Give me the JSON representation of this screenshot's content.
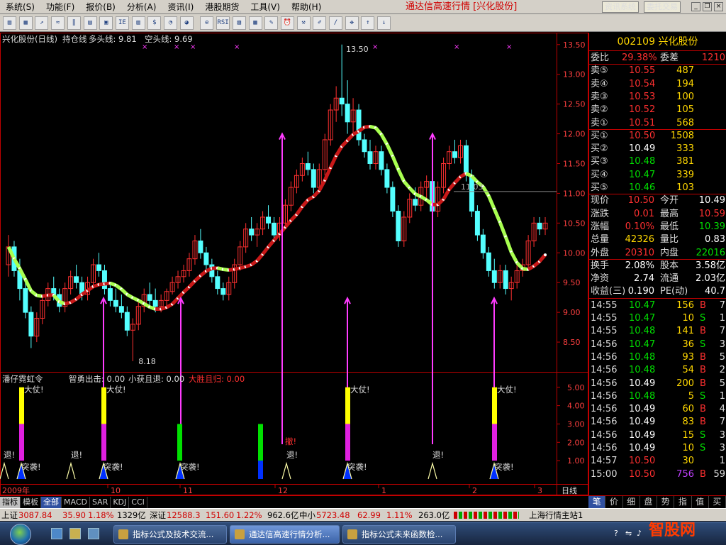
{
  "menubar": {
    "items": [
      "系统(S)",
      "功能(F)",
      "报价(B)",
      "分析(A)",
      "资讯(I)",
      "港股期货",
      "工具(V)",
      "帮助(H)"
    ],
    "app_title": "通达信高速行情 [兴化股份]",
    "news_button": "资讯系统",
    "trade_button": "委托交易"
  },
  "toolbar": {
    "icons": [
      "chart-icon",
      "table-icon",
      "line-chart-icon",
      "trend-icon",
      "candle-icon",
      "layout-icon",
      "depth-icon",
      "report-icon",
      "db-icon",
      "money-icon",
      "pie-icon",
      "pie2-icon",
      "ie-icon",
      "rsi-icon",
      "screen-icon",
      "grid-icon",
      "pen-icon",
      "alarm-icon",
      "tools-icon",
      "sign-icon",
      "draw-icon",
      "move-icon",
      "up-arrow-icon",
      "down-arrow-icon"
    ],
    "labels": [
      "▥",
      "▦",
      "↗",
      "≈",
      "‖",
      "▤",
      "▣",
      "IE",
      "▥",
      "$",
      "◔",
      "◕",
      "e",
      "RSI",
      "▧",
      "▦",
      "✎",
      "⏰",
      "⚒",
      "✐",
      "/",
      "✥",
      "↑",
      "↓"
    ]
  },
  "chart": {
    "header_stock": "兴化股份(日线)",
    "header_indicator": "持仓线",
    "long_line_label": "多头线: 9.81",
    "short_line_label": "空头线: 9.69",
    "price_ticks": [
      "13.50",
      "13.00",
      "12.50",
      "12.00",
      "11.50",
      "11.00",
      "10.50",
      "10.00",
      "9.50",
      "9.00",
      "8.50"
    ],
    "high_label": "13.50",
    "low_label": "8.18",
    "hline_label": "11.03",
    "sub_title": "潘仔霓虹令",
    "sub_label1": "智勇出击: 0.00",
    "sub_label2": "小获且退: 0.00",
    "sub_label3": "大胜且归: 0.00",
    "sub_ticks": [
      "5.00",
      "4.00",
      "3.00",
      "2.00",
      "1.00"
    ],
    "date_labels": [
      "2009年",
      "10",
      "11",
      "12",
      "1",
      "2",
      "3"
    ],
    "period": "日线",
    "sig_buy": "大仗!",
    "sig_exit": "退!",
    "sig_raid": "突袭!",
    "sig_retreat": "撤!",
    "colors": {
      "up": "#ff3030",
      "down": "#54ffff",
      "long": "#a8ff50",
      "short": "#c81818",
      "arrow": "#ff3cff",
      "yellow": "#ffff00",
      "magenta": "#e020e0",
      "green": "#00e000",
      "blue": "#0030ff"
    }
  },
  "chart_data": {
    "type": "candlestick",
    "ylim": [
      8.0,
      13.7
    ],
    "candles": [
      [
        9.8,
        10.3,
        9.6,
        10.1
      ],
      [
        10.1,
        10.2,
        9.6,
        9.7
      ],
      [
        9.7,
        9.9,
        9.2,
        9.4
      ],
      [
        9.4,
        9.5,
        8.9,
        9.0
      ],
      [
        9.0,
        9.1,
        8.4,
        8.6
      ],
      [
        8.6,
        9.0,
        8.5,
        8.9
      ],
      [
        8.9,
        9.3,
        8.8,
        9.2
      ],
      [
        9.2,
        9.5,
        9.1,
        9.4
      ],
      [
        9.4,
        9.6,
        9.2,
        9.3
      ],
      [
        9.3,
        9.4,
        9.0,
        9.1
      ],
      [
        9.1,
        9.5,
        9.0,
        9.4
      ],
      [
        9.4,
        9.7,
        9.3,
        9.6
      ],
      [
        9.6,
        9.8,
        9.4,
        9.5
      ],
      [
        9.5,
        9.6,
        9.2,
        9.3
      ],
      [
        9.3,
        9.6,
        9.2,
        9.5
      ],
      [
        9.5,
        9.9,
        9.4,
        9.8
      ],
      [
        9.8,
        10.0,
        9.6,
        9.7
      ],
      [
        9.7,
        9.8,
        9.3,
        9.4
      ],
      [
        9.4,
        9.5,
        9.1,
        9.2
      ],
      [
        9.2,
        9.4,
        9.0,
        9.1
      ],
      [
        9.1,
        9.3,
        8.9,
        9.0
      ],
      [
        9.0,
        9.1,
        8.6,
        8.7
      ],
      [
        8.7,
        8.9,
        8.18,
        8.8
      ],
      [
        8.8,
        9.2,
        8.7,
        9.1
      ],
      [
        9.1,
        9.4,
        9.0,
        9.3
      ],
      [
        9.3,
        9.5,
        9.1,
        9.2
      ],
      [
        9.2,
        9.4,
        9.0,
        9.1
      ],
      [
        9.1,
        9.3,
        9.0,
        9.2
      ],
      [
        9.2,
        9.4,
        9.1,
        9.35
      ],
      [
        9.35,
        9.6,
        9.3,
        9.5
      ],
      [
        9.5,
        9.7,
        9.4,
        9.6
      ],
      [
        9.6,
        9.8,
        9.5,
        9.7
      ],
      [
        9.7,
        10.0,
        9.6,
        9.9
      ],
      [
        9.9,
        10.3,
        9.8,
        10.2
      ],
      [
        10.2,
        10.4,
        9.9,
        10.0
      ],
      [
        10.0,
        10.1,
        9.7,
        9.8
      ],
      [
        9.8,
        9.9,
        9.5,
        9.6
      ],
      [
        9.6,
        9.7,
        9.3,
        9.4
      ],
      [
        9.4,
        9.5,
        9.2,
        9.3
      ],
      [
        9.3,
        9.6,
        9.2,
        9.5
      ],
      [
        9.5,
        9.9,
        9.4,
        9.8
      ],
      [
        9.8,
        10.2,
        9.7,
        10.1
      ],
      [
        10.1,
        10.5,
        10.0,
        10.4
      ],
      [
        10.4,
        10.6,
        10.2,
        10.3
      ],
      [
        10.3,
        10.5,
        10.1,
        10.4
      ],
      [
        10.4,
        10.7,
        10.3,
        10.6
      ],
      [
        10.6,
        10.8,
        10.4,
        10.5
      ],
      [
        10.5,
        10.6,
        10.2,
        10.3
      ],
      [
        10.3,
        10.6,
        10.2,
        10.5
      ],
      [
        10.5,
        10.9,
        10.4,
        10.8
      ],
      [
        10.8,
        11.2,
        10.7,
        11.1
      ],
      [
        11.1,
        11.4,
        11.0,
        11.3
      ],
      [
        11.3,
        11.6,
        11.2,
        11.5
      ],
      [
        11.5,
        11.7,
        11.3,
        11.4
      ],
      [
        11.4,
        11.5,
        11.0,
        11.1
      ],
      [
        11.1,
        11.5,
        11.0,
        11.4
      ],
      [
        11.4,
        12.0,
        11.3,
        11.9
      ],
      [
        11.9,
        12.5,
        11.8,
        12.4
      ],
      [
        12.4,
        12.8,
        12.2,
        12.6
      ],
      [
        12.6,
        13.5,
        12.3,
        12.5
      ],
      [
        12.5,
        12.9,
        12.0,
        12.2
      ],
      [
        12.2,
        12.6,
        12.0,
        12.4
      ],
      [
        12.4,
        12.5,
        11.8,
        11.9
      ],
      [
        11.9,
        12.0,
        11.6,
        11.7
      ],
      [
        11.7,
        11.9,
        11.4,
        11.5
      ],
      [
        11.5,
        11.8,
        11.4,
        11.7
      ],
      [
        11.7,
        11.8,
        11.3,
        11.4
      ],
      [
        11.4,
        11.5,
        11.0,
        11.1
      ],
      [
        11.1,
        11.2,
        10.6,
        10.7
      ],
      [
        10.7,
        10.8,
        10.1,
        10.2
      ],
      [
        10.2,
        10.7,
        10.1,
        10.6
      ],
      [
        10.6,
        11.0,
        10.5,
        10.9
      ],
      [
        10.9,
        11.1,
        10.7,
        10.8
      ],
      [
        10.8,
        11.2,
        10.7,
        11.1
      ],
      [
        11.1,
        11.3,
        10.9,
        11.2
      ],
      [
        11.2,
        11.3,
        10.6,
        10.7
      ],
      [
        10.7,
        11.2,
        10.6,
        11.1
      ],
      [
        11.1,
        11.6,
        11.0,
        11.5
      ],
      [
        11.5,
        11.8,
        11.4,
        11.7
      ],
      [
        11.7,
        11.9,
        11.5,
        11.6
      ],
      [
        11.6,
        11.9,
        11.5,
        11.8
      ],
      [
        11.8,
        11.9,
        11.2,
        11.3
      ],
      [
        11.3,
        11.4,
        10.6,
        10.7
      ],
      [
        10.7,
        10.8,
        10.2,
        10.3
      ],
      [
        10.3,
        10.4,
        9.9,
        10.0
      ],
      [
        10.0,
        10.1,
        9.6,
        9.7
      ],
      [
        9.7,
        9.9,
        9.4,
        9.5
      ],
      [
        9.5,
        9.8,
        9.4,
        9.7
      ],
      [
        9.7,
        9.8,
        9.3,
        9.4
      ],
      [
        9.4,
        9.6,
        9.2,
        9.5
      ],
      [
        9.5,
        9.8,
        9.4,
        9.7
      ],
      [
        9.7,
        9.9,
        9.6,
        9.8
      ],
      [
        9.8,
        10.3,
        9.7,
        10.2
      ],
      [
        10.2,
        10.6,
        10.1,
        10.5
      ],
      [
        10.5,
        10.6,
        10.3,
        10.4
      ],
      [
        10.4,
        10.6,
        10.3,
        10.5
      ]
    ]
  },
  "quote": {
    "code_name": "002109 兴化股份",
    "ratio_label": "委比",
    "ratio_value": "29.38%",
    "diff_label": "委差",
    "diff_value": "1210",
    "asks": [
      [
        "卖⑤",
        "10.55",
        "487"
      ],
      [
        "卖④",
        "10.54",
        "194"
      ],
      [
        "卖③",
        "10.53",
        "100"
      ],
      [
        "卖②",
        "10.52",
        "105"
      ],
      [
        "卖①",
        "10.51",
        "568"
      ]
    ],
    "bids": [
      [
        "买①",
        "10.50",
        "1508"
      ],
      [
        "买②",
        "10.49",
        "333"
      ],
      [
        "买③",
        "10.48",
        "381"
      ],
      [
        "买④",
        "10.47",
        "339"
      ],
      [
        "买⑤",
        "10.46",
        "103"
      ]
    ],
    "stats": [
      [
        "现价",
        "10.50",
        "今开",
        "10.49"
      ],
      [
        "涨跌",
        "0.01",
        "最高",
        "10.59"
      ],
      [
        "涨幅",
        "0.10%",
        "最低",
        "10.39"
      ],
      [
        "总量",
        "42326",
        "量比",
        "0.83"
      ],
      [
        "外盘",
        "20310",
        "内盘",
        "22016"
      ],
      [
        "换手",
        "2.08%",
        "股本",
        "3.58亿"
      ],
      [
        "净资",
        "2.74",
        "流通",
        "2.03亿"
      ],
      [
        "收益(三)",
        "0.190",
        "PE(动)",
        "40.7"
      ]
    ],
    "ticks": [
      [
        "14:55",
        "10.47",
        "156",
        "B",
        "7"
      ],
      [
        "14:55",
        "10.47",
        "10",
        "S",
        "1"
      ],
      [
        "14:55",
        "10.48",
        "141",
        "B",
        "7"
      ],
      [
        "14:56",
        "10.47",
        "36",
        "S",
        "3"
      ],
      [
        "14:56",
        "10.48",
        "93",
        "B",
        "5"
      ],
      [
        "14:56",
        "10.48",
        "54",
        "B",
        "2"
      ],
      [
        "14:56",
        "10.49",
        "200",
        "B",
        "5"
      ],
      [
        "14:56",
        "10.48",
        "5",
        "S",
        "1"
      ],
      [
        "14:56",
        "10.49",
        "60",
        "B",
        "4"
      ],
      [
        "14:56",
        "10.49",
        "83",
        "B",
        "7"
      ],
      [
        "14:56",
        "10.49",
        "15",
        "S",
        "3"
      ],
      [
        "14:56",
        "10.49",
        "10",
        "S",
        "3"
      ],
      [
        "14:57",
        "10.50",
        "30",
        "",
        "1"
      ],
      [
        "15:00",
        "10.50",
        "756",
        "B",
        "59"
      ]
    ]
  },
  "bottom_tabs": [
    "指标",
    "模板",
    "全部",
    "MACD",
    "SAR",
    "KDJ",
    "CCI"
  ],
  "right_tabs": [
    "笔",
    "价",
    "细",
    "盘",
    "势",
    "指",
    "值",
    "买"
  ],
  "status": {
    "sh_label": "上证",
    "sh_value": "3087.84",
    "sh_change": "35.90",
    "sh_pct": "1.18%",
    "sh_amount": "1329亿",
    "sz_label": "深证",
    "sz_value": "12588.3",
    "sz_change": "151.60",
    "sz_pct": "1.22%",
    "sz_amount": "962.6亿",
    "sme_label": "中小",
    "sme_value": "5723.48",
    "sme_change": "62.99",
    "sme_pct": "1.11%",
    "sme_amount": "263.0亿",
    "station": "上海行情主站1"
  },
  "taskbar": {
    "tasks": [
      "指标公式及技术交流...",
      "通达信高速行情分析...",
      "指标公式未来函数检..."
    ],
    "watermark": "智股网"
  }
}
